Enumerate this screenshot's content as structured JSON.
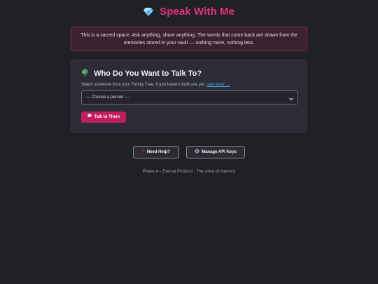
{
  "header": {
    "title": "Speak With Me",
    "icon": "gem-icon"
  },
  "notice": {
    "text": "This is a sacred space. Ask anything, share anything. The words that come back are drawn from the memories stored in your vault — nothing more, nothing less."
  },
  "card": {
    "heading": "Who Do You Want to Talk To?",
    "heading_icon": "tree-icon",
    "subtitle": "Select someone from your Family Tree. If you haven't built one yet,",
    "link_label": "start here →",
    "select_value": "— Choose a person —",
    "talk_button_label": "Talk to Them"
  },
  "actions": {
    "help_label": "Need Help?",
    "api_keys_label": "Manage API Keys"
  },
  "footer": {
    "text": "Phase 4 – Eternal Protocol · The voice of memory"
  },
  "colors": {
    "accent": "#e0347a",
    "button": "#c31d5e",
    "background": "#202127",
    "card": "#2b2c36",
    "link": "#4aa3f0"
  }
}
